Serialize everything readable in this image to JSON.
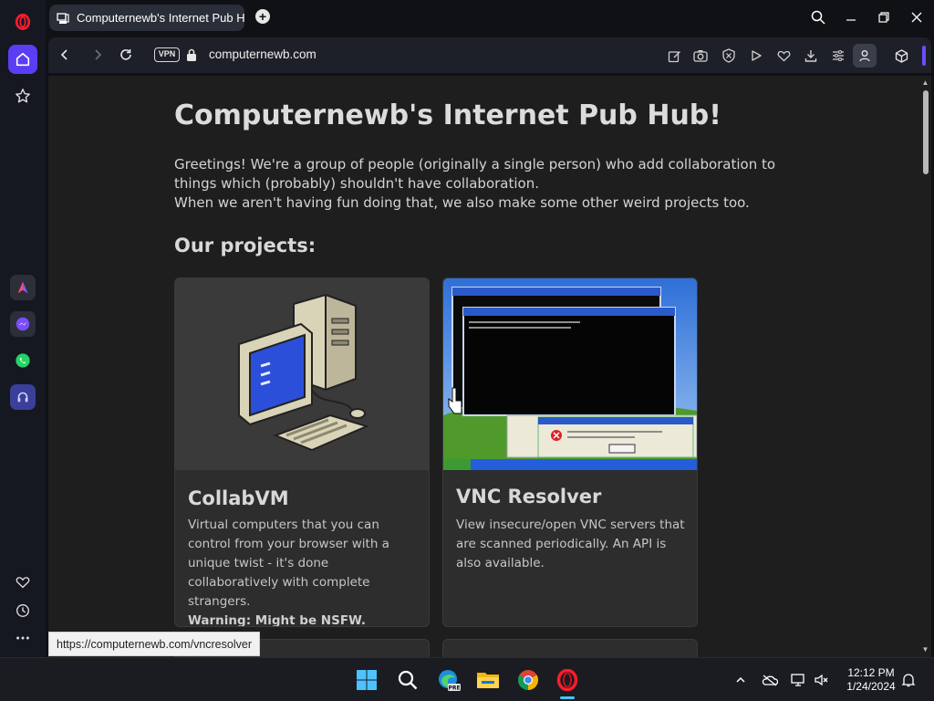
{
  "browser": {
    "tab_title": "Computernewb's Internet Pub Hub!",
    "new_tab_label": "+",
    "vpn_label": "VPN",
    "url": "computernewb.com",
    "status_url": "https://computernewb.com/vncresolver",
    "accent_color": "#5b3df5"
  },
  "page": {
    "title": "Computernewb's Internet Pub Hub!",
    "intro_line1": "Greetings! We're a group of people (originally a single person) who add collaboration to things which (probably) shouldn't have collaboration.",
    "intro_line2": "When we aren't having fun doing that, we also make some other weird projects too.",
    "projects_heading": "Our projects:",
    "cards": [
      {
        "title": "CollabVM",
        "description": "Virtual computers that you can control from your browser with a unique twist - it's done collaboratively with complete strangers.",
        "warning": "Warning: Might be NSFW.",
        "image_icon": "retro-computer-illustration"
      },
      {
        "title": "VNC Resolver",
        "description": "View insecure/open VNC servers that are scanned periodically. An API is also available.",
        "image_icon": "windows-xp-screenshot"
      }
    ]
  },
  "sidebar": {
    "icons": [
      "opera-logo-icon",
      "home-icon",
      "star-icon",
      "aria-icon",
      "messenger-icon",
      "whatsapp-icon",
      "music-player-icon",
      "heart-icon",
      "history-icon",
      "more-icon"
    ]
  },
  "taskbar": {
    "apps": [
      "windows-start-icon",
      "search-icon",
      "edge-beta-icon",
      "file-explorer-icon",
      "chrome-icon",
      "opera-icon"
    ],
    "clock_time": "12:12 PM",
    "clock_date": "1/24/2024"
  }
}
